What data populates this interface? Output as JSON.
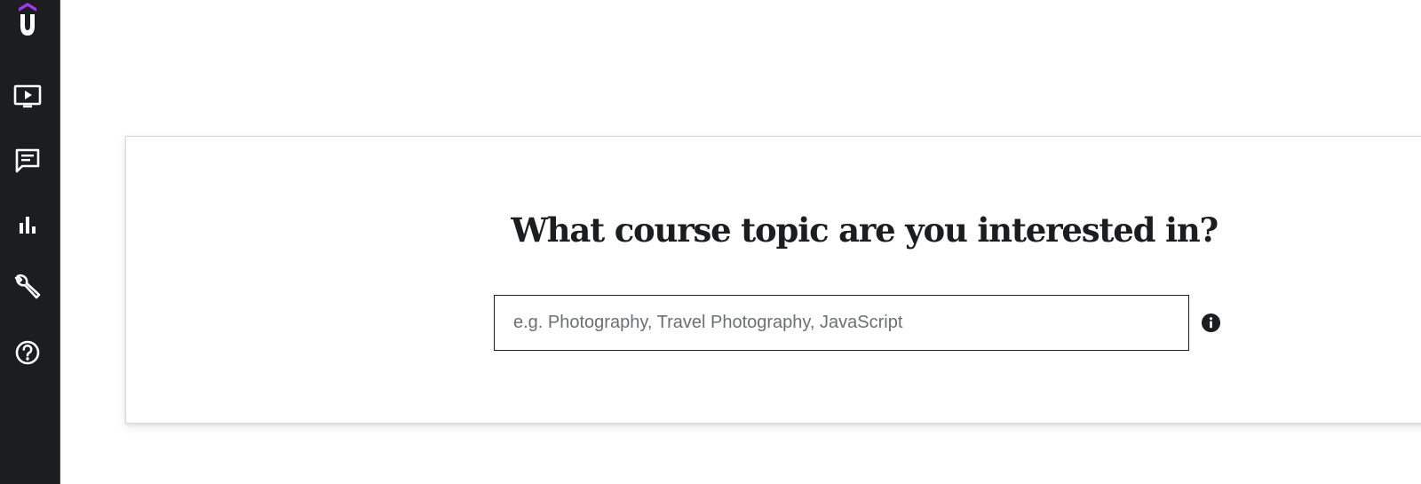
{
  "sidebar": {
    "logo_icon": "udemy-logo-icon",
    "items": [
      {
        "icon": "courses-video-icon"
      },
      {
        "icon": "communication-chat-icon"
      },
      {
        "icon": "performance-chart-icon"
      },
      {
        "icon": "tools-wrench-icon"
      },
      {
        "icon": "help-circle-icon"
      }
    ]
  },
  "main": {
    "heading": "What course topic are you interested in?",
    "search": {
      "value": "",
      "placeholder": "e.g. Photography, Travel Photography, JavaScript"
    },
    "info_icon": "info-icon"
  },
  "colors": {
    "sidebar_bg": "#1c1d1f",
    "brand_purple": "#a435f0",
    "text_dark": "#1c1d1f",
    "placeholder": "#6a6f73"
  }
}
